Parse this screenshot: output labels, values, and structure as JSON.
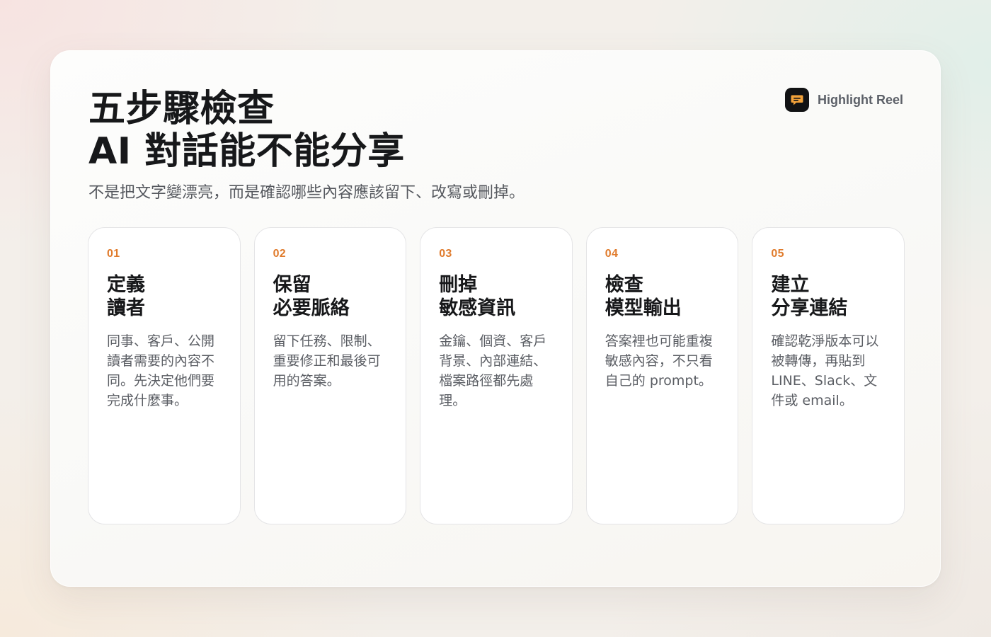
{
  "header": {
    "title_line1": "五步驟檢查",
    "title_line2": "AI 對話能不能分享",
    "subtitle": "不是把文字變漂亮，而是確認哪些內容應該留下、改寫或刪掉。"
  },
  "brand": {
    "name": "Highlight Reel",
    "icon": "chat-bubble-icon"
  },
  "colors": {
    "accent": "#e07b2c",
    "brand_bubble": "#f2a23a",
    "logo_bg": "#111214"
  },
  "steps": [
    {
      "number": "01",
      "title_lines": [
        "定義",
        "讀者"
      ],
      "body_lines": [
        "同事、客戶、公開",
        "讀者需要的內容不",
        "同。先決定他們要",
        "完成什麼事。"
      ]
    },
    {
      "number": "02",
      "title_lines": [
        "保留",
        "必要脈絡"
      ],
      "body_lines": [
        "留下任務、限制、",
        "重要修正和最後可",
        "用的答案。"
      ]
    },
    {
      "number": "03",
      "title_lines": [
        "刪掉",
        "敏感資訊"
      ],
      "body_lines": [
        "金鑰、個資、客戶",
        "背景、內部連結、",
        "檔案路徑都先處",
        "理。"
      ]
    },
    {
      "number": "04",
      "title_lines": [
        "檢查",
        "模型輸出"
      ],
      "body_lines": [
        "答案裡也可能重複",
        "敏感內容，不只看",
        "自己的 prompt。"
      ]
    },
    {
      "number": "05",
      "title_lines": [
        "建立",
        "分享連結"
      ],
      "body_lines": [
        "確認乾淨版本可以",
        "被轉傳，再貼到",
        "LINE、Slack、文",
        "件或 email。"
      ]
    }
  ]
}
